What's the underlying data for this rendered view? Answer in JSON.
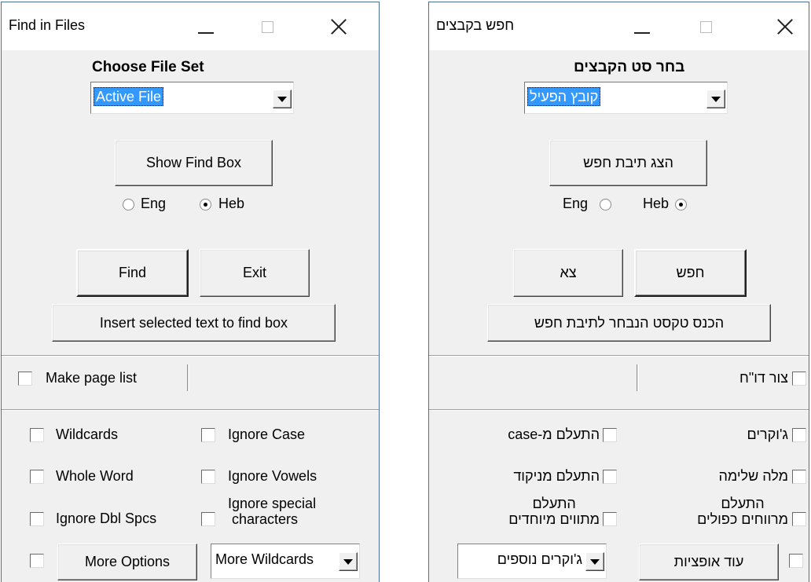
{
  "english": {
    "title": "Find in Files",
    "heading": "Choose File Set",
    "file_set_selected": "Active File",
    "show_find_box": "Show Find Box",
    "lang_eng": "Eng",
    "lang_heb": "Heb",
    "find": "Find",
    "exit": "Exit",
    "insert_selected": "Insert selected text to find box",
    "make_page_list": "Make page list",
    "options": {
      "wildcards": "Wildcards",
      "ignore_case": "Ignore Case",
      "whole_word": "Whole Word",
      "ignore_vowels": "Ignore Vowels",
      "ignore_dbl_spcs": "Ignore Dbl Spcs",
      "ignore_special_1": "Ignore special",
      "ignore_special_2": "characters"
    },
    "more_options": "More Options",
    "more_wildcards": "More Wildcards"
  },
  "hebrew": {
    "title": "חפש בקבצים",
    "heading": "בחר סט הקבצים",
    "file_set_selected": "קובץ הפעיל",
    "show_find_box": "הצג תיבת חפש",
    "lang_eng": "Eng",
    "lang_heb": "Heb",
    "find": "חפש",
    "exit": "צא",
    "insert_selected": "הכנס טקסט הנבחר לתיבת חפש",
    "make_page_list": "צור דו\"ח",
    "options": {
      "wildcards": "ג'וקרים",
      "ignore_case": "התעלם מ-case",
      "whole_word": "מלה שלימה",
      "ignore_vowels": "התעלם מניקוד",
      "ignore_dbl_spcs_1": "התעלם",
      "ignore_dbl_spcs_2": "מרווחים כפולים",
      "ignore_special_1": "התעלם",
      "ignore_special_2": "מתווים מיוחדים"
    },
    "more_options": "עוד אופציות",
    "more_wildcards": "ג'וקרים נוספים"
  },
  "language_selected": "Heb"
}
